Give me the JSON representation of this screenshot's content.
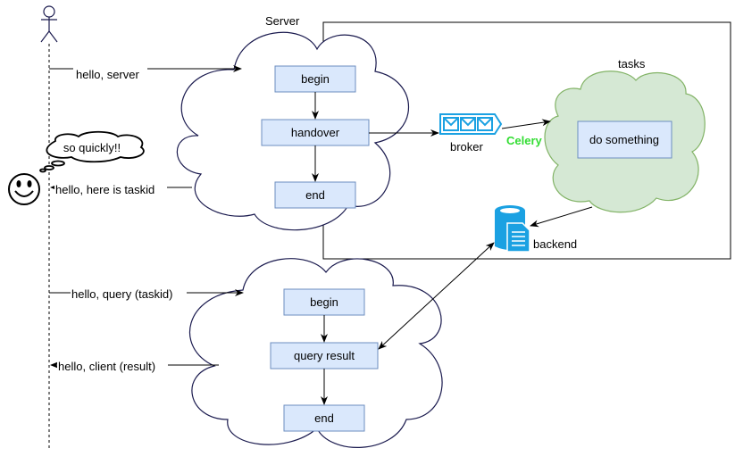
{
  "labels": {
    "server": "Server",
    "tasks": "tasks",
    "broker": "broker",
    "celery": "Celery",
    "backend": "backend",
    "thought": "so quickly!!"
  },
  "server1": {
    "begin": "begin",
    "handover": "handover",
    "end": "end"
  },
  "server2": {
    "begin": "begin",
    "query": "query result",
    "end": "end"
  },
  "task_box": "do something",
  "messages": {
    "hello_server": "hello, server",
    "taskid": "hello, here is taskid",
    "query": "hello, query (taskid)",
    "result": "hello, client (result)"
  },
  "colors": {
    "box_fill": "#dae8fc",
    "box_stroke": "#6c8ebf",
    "cloud_stroke": "#1a1a4e",
    "task_cloud_fill": "#d5e8d4",
    "task_cloud_stroke": "#82b366",
    "celery": "#33dd33",
    "icon_blue": "#1ba1e2"
  },
  "icons": [
    "actor-icon",
    "smiley-icon",
    "queue-icon",
    "database-icon"
  ]
}
